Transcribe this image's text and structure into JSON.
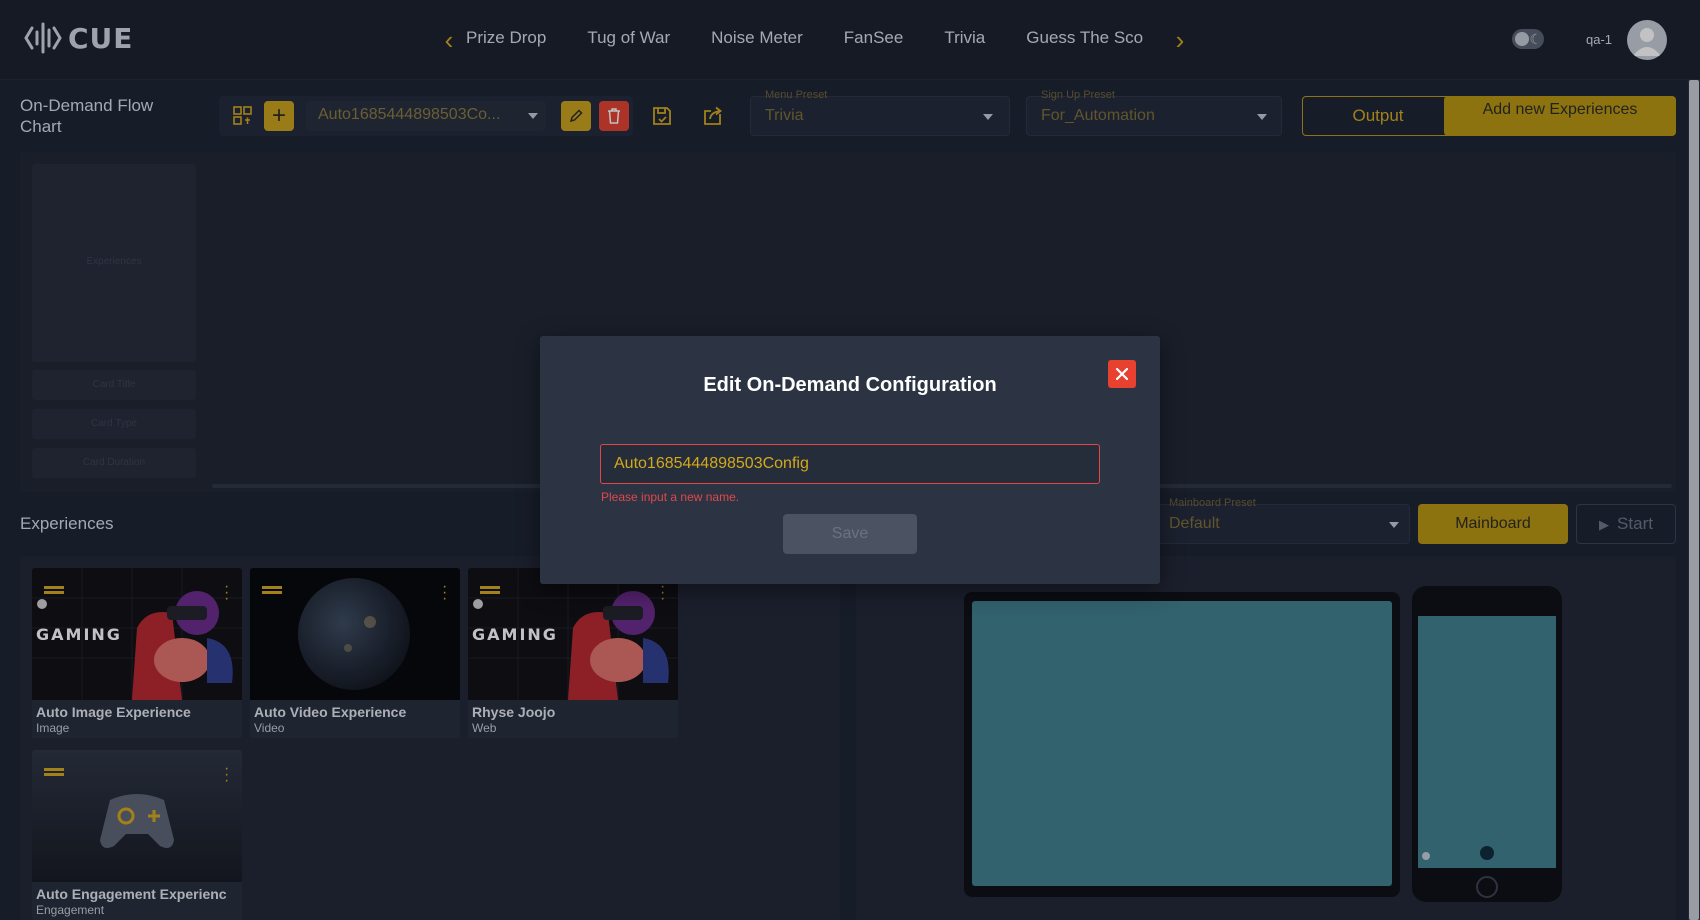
{
  "app": {
    "logo_text": "CUE",
    "user_name": "qa-1"
  },
  "nav": {
    "tabs": [
      "Prize Drop",
      "Tug of War",
      "Noise Meter",
      "FanSee",
      "Trivia",
      "Guess The Sco"
    ]
  },
  "toolbar": {
    "page_title": "On-Demand Flow Chart",
    "config_value": "Auto1685444898503Co...",
    "menu_preset_label": "Menu Preset",
    "menu_preset_value": "Trivia",
    "signup_preset_label": "Sign Up Preset",
    "signup_preset_value": "For_Automation",
    "output_label": "Output",
    "add_label": "Add new Experiences"
  },
  "canvas": {
    "side_cards": [
      "Experiences",
      "Card Title",
      "Card Type",
      "Card Duration"
    ]
  },
  "experiences": {
    "title": "Experiences",
    "items": [
      {
        "name": "Auto Image Experience",
        "type": "Image",
        "thumb_text": "GAMING"
      },
      {
        "name": "Auto Video Experience",
        "type": "Video"
      },
      {
        "name": "Rhyse Joojo",
        "type": "Web",
        "thumb_text": "GAMING"
      },
      {
        "name": "Auto Engagement Experienc",
        "type": "Engagement"
      }
    ]
  },
  "preview": {
    "mainboard_preset_label": "Mainboard Preset",
    "mainboard_preset_value": "Default",
    "mainboard_label": "Mainboard",
    "start_label": "Start"
  },
  "modal": {
    "title": "Edit On-Demand Configuration",
    "input_value": "Auto1685444898503Config",
    "error": "Please input a new name.",
    "save_label": "Save"
  },
  "colors": {
    "accent": "#d4a91c",
    "danger": "#e8412f",
    "screen": "#3f7f8d"
  }
}
